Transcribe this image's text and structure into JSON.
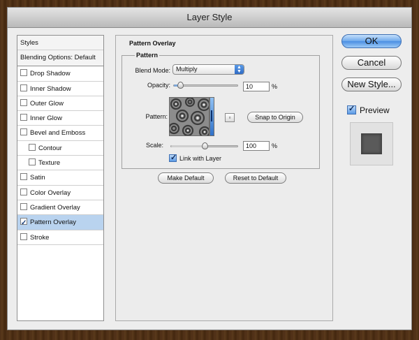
{
  "window": {
    "title": "Layer Style"
  },
  "styles_list": {
    "header": "Styles",
    "blending": "Blending Options: Default",
    "items": [
      {
        "label": "Drop Shadow",
        "checked": false,
        "indent": false
      },
      {
        "label": "Inner Shadow",
        "checked": false,
        "indent": false
      },
      {
        "label": "Outer Glow",
        "checked": false,
        "indent": false
      },
      {
        "label": "Inner Glow",
        "checked": false,
        "indent": false
      },
      {
        "label": "Bevel and Emboss",
        "checked": false,
        "indent": false
      },
      {
        "label": "Contour",
        "checked": false,
        "indent": true
      },
      {
        "label": "Texture",
        "checked": false,
        "indent": true
      },
      {
        "label": "Satin",
        "checked": false,
        "indent": false
      },
      {
        "label": "Color Overlay",
        "checked": false,
        "indent": false
      },
      {
        "label": "Gradient Overlay",
        "checked": false,
        "indent": false
      },
      {
        "label": "Pattern Overlay",
        "checked": true,
        "indent": false,
        "selected": true
      },
      {
        "label": "Stroke",
        "checked": false,
        "indent": false
      }
    ]
  },
  "pattern_overlay": {
    "section_title": "Pattern Overlay",
    "group_title": "Pattern",
    "blend_mode_label": "Blend Mode:",
    "blend_mode_value": "Multiply",
    "opacity_label": "Opacity:",
    "opacity_value": "10",
    "opacity_fraction": 0.1,
    "percent": "%",
    "pattern_label": "Pattern:",
    "snap_button": "Snap to Origin",
    "scale_label": "Scale:",
    "scale_value": "100",
    "scale_fraction": 0.5,
    "link_label": "Link with Layer",
    "link_checked": true,
    "make_default": "Make Default",
    "reset_default": "Reset to Default"
  },
  "buttons": {
    "ok": "OK",
    "cancel": "Cancel",
    "new_style": "New Style...",
    "preview": "Preview",
    "preview_checked": true
  },
  "colors": {
    "accent": "#4b8fe2",
    "selection": "#b9d3ef",
    "background": "#ededed"
  }
}
